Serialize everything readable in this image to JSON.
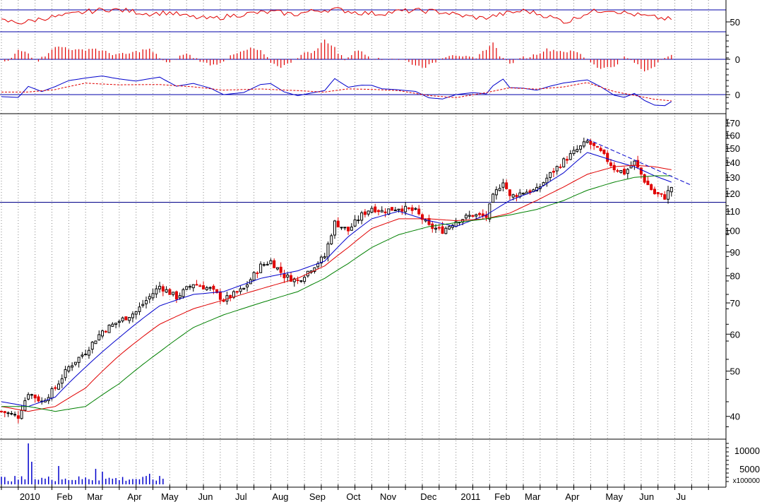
{
  "chart_data": {
    "type": "candlestick",
    "scale": "log",
    "y_ticks": [
      40,
      50,
      60,
      70,
      80,
      90,
      100,
      110,
      120,
      130,
      140,
      150,
      160,
      170
    ],
    "ylim": [
      36,
      178
    ],
    "horizontal_support": 115,
    "trendline": {
      "from": {
        "x": 174,
        "y": 157
      },
      "to": {
        "x": 205,
        "y": 125
      }
    },
    "x_labels": [
      "2010",
      "Feb",
      "Mar",
      "Apr",
      "May",
      "Jun",
      "Jul",
      "Aug",
      "Sep",
      "Oct",
      "Nov",
      "Dec",
      "2011",
      "Feb",
      "Mar",
      "Apr",
      "May",
      "Jun",
      "Ju"
    ],
    "x_label_bars": [
      5,
      16,
      25,
      37,
      47,
      58,
      69,
      80,
      91,
      102,
      112,
      124,
      136,
      146,
      155,
      167,
      179,
      189,
      200
    ],
    "bars_total": 212,
    "price_anchors": [
      [
        0,
        41
      ],
      [
        5,
        40
      ],
      [
        8,
        45
      ],
      [
        12,
        43
      ],
      [
        16,
        46
      ],
      [
        20,
        51
      ],
      [
        25,
        55
      ],
      [
        30,
        61
      ],
      [
        35,
        64
      ],
      [
        40,
        67
      ],
      [
        47,
        76
      ],
      [
        52,
        72
      ],
      [
        57,
        77
      ],
      [
        62,
        75
      ],
      [
        66,
        71
      ],
      [
        72,
        75
      ],
      [
        77,
        84
      ],
      [
        80,
        86
      ],
      [
        84,
        80
      ],
      [
        88,
        78
      ],
      [
        92,
        83
      ],
      [
        96,
        88
      ],
      [
        99,
        104
      ],
      [
        103,
        100
      ],
      [
        107,
        108
      ],
      [
        110,
        112
      ],
      [
        113,
        110
      ],
      [
        118,
        112
      ],
      [
        123,
        110
      ],
      [
        127,
        102
      ],
      [
        131,
        100
      ],
      [
        135,
        105
      ],
      [
        140,
        108
      ],
      [
        144,
        107
      ],
      [
        146,
        118
      ],
      [
        149,
        128
      ],
      [
        151,
        118
      ],
      [
        155,
        121
      ],
      [
        159,
        122
      ],
      [
        163,
        132
      ],
      [
        167,
        141
      ],
      [
        171,
        149
      ],
      [
        174,
        155
      ],
      [
        178,
        147
      ],
      [
        182,
        136
      ],
      [
        185,
        133
      ],
      [
        188,
        140
      ],
      [
        191,
        128
      ],
      [
        194,
        120
      ],
      [
        197,
        118
      ],
      [
        199,
        124
      ]
    ],
    "ma_fast_anchors": [
      [
        0,
        43
      ],
      [
        8,
        42
      ],
      [
        16,
        44
      ],
      [
        25,
        51
      ],
      [
        35,
        59
      ],
      [
        47,
        69
      ],
      [
        57,
        73
      ],
      [
        66,
        74
      ],
      [
        77,
        79
      ],
      [
        88,
        82
      ],
      [
        96,
        86
      ],
      [
        103,
        97
      ],
      [
        110,
        106
      ],
      [
        118,
        110
      ],
      [
        127,
        105
      ],
      [
        135,
        102
      ],
      [
        144,
        108
      ],
      [
        151,
        116
      ],
      [
        159,
        122
      ],
      [
        167,
        133
      ],
      [
        174,
        147
      ],
      [
        182,
        141
      ],
      [
        188,
        137
      ],
      [
        194,
        131
      ],
      [
        199,
        127
      ]
    ],
    "ma_mid_anchors": [
      [
        0,
        42
      ],
      [
        8,
        41
      ],
      [
        16,
        42
      ],
      [
        25,
        46
      ],
      [
        35,
        54
      ],
      [
        47,
        63
      ],
      [
        57,
        68
      ],
      [
        66,
        71
      ],
      [
        77,
        75
      ],
      [
        88,
        79
      ],
      [
        96,
        84
      ],
      [
        103,
        92
      ],
      [
        110,
        101
      ],
      [
        118,
        106
      ],
      [
        127,
        106
      ],
      [
        135,
        105
      ],
      [
        144,
        106
      ],
      [
        151,
        109
      ],
      [
        159,
        116
      ],
      [
        167,
        124
      ],
      [
        174,
        132
      ],
      [
        182,
        137
      ],
      [
        188,
        138
      ],
      [
        194,
        137
      ],
      [
        199,
        135
      ]
    ],
    "ma_slow_anchors": [
      [
        0,
        42
      ],
      [
        8,
        42
      ],
      [
        16,
        41
      ],
      [
        25,
        42
      ],
      [
        35,
        47
      ],
      [
        47,
        55
      ],
      [
        57,
        62
      ],
      [
        66,
        66
      ],
      [
        77,
        70
      ],
      [
        88,
        74
      ],
      [
        96,
        79
      ],
      [
        103,
        85
      ],
      [
        110,
        92
      ],
      [
        118,
        98
      ],
      [
        127,
        102
      ],
      [
        135,
        104
      ],
      [
        144,
        106
      ],
      [
        151,
        108
      ],
      [
        159,
        111
      ],
      [
        167,
        116
      ],
      [
        174,
        122
      ],
      [
        182,
        127
      ],
      [
        188,
        130
      ],
      [
        194,
        131
      ],
      [
        199,
        131
      ]
    ],
    "rsi": {
      "values_approx": [
        44,
        41,
        48,
        52,
        58,
        62,
        60,
        55,
        57,
        50,
        47,
        52,
        56,
        58,
        54,
        60,
        62,
        57,
        55,
        59,
        60,
        58,
        52,
        48,
        55,
        60,
        52,
        42,
        57,
        62,
        55,
        50,
        46
      ],
      "ticks": [
        50
      ]
    },
    "histogram": {
      "ticks": [
        0
      ]
    },
    "macd": {
      "ticks": [
        0
      ]
    },
    "volume": {
      "ticks": [
        "10000",
        "5000"
      ],
      "multiplier_label": "x100000"
    },
    "series_colors": {
      "up": "#000000",
      "down": "#e00000",
      "ma_fast": "#0000cc",
      "ma_mid": "#e00000",
      "ma_slow": "#008000",
      "grid": "#888888",
      "axis_lines": "#0000aa"
    }
  }
}
